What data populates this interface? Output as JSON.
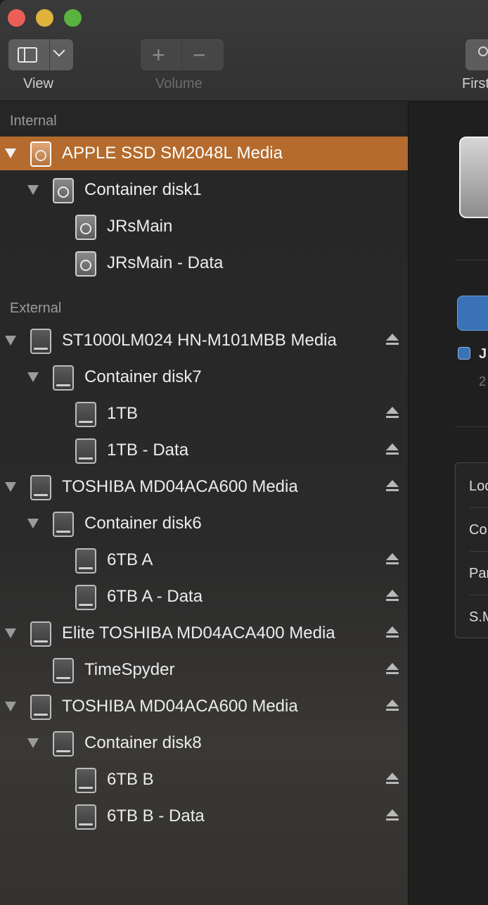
{
  "toolbar": {
    "view_label": "View",
    "volume_label": "Volume",
    "first_aid_label": "First Aid",
    "plus": "+",
    "minus": "−"
  },
  "sidebar": {
    "internal_header": "Internal",
    "external_header": "External",
    "items": [
      {
        "label": "APPLE SSD SM2048L Media"
      },
      {
        "label": "Container disk1"
      },
      {
        "label": "JRsMain"
      },
      {
        "label": "JRsMain - Data"
      },
      {
        "label": "ST1000LM024 HN-M101MBB Media"
      },
      {
        "label": "Container disk7"
      },
      {
        "label": "1TB"
      },
      {
        "label": "1TB - Data"
      },
      {
        "label": "TOSHIBA MD04ACA600 Media"
      },
      {
        "label": "Container disk6"
      },
      {
        "label": "6TB A"
      },
      {
        "label": "6TB A - Data"
      },
      {
        "label": "Elite TOSHIBA MD04ACA400 Media"
      },
      {
        "label": "TimeSpyder"
      },
      {
        "label": "TOSHIBA MD04ACA600 Media"
      },
      {
        "label": "Container disk8"
      },
      {
        "label": "6TB B"
      },
      {
        "label": "6TB B - Data"
      }
    ]
  },
  "detail": {
    "legend_letter": "J",
    "legend_sub": "2",
    "info_rows": [
      "Loc",
      "Co",
      "Par",
      "S.M"
    ]
  },
  "colors": {
    "selection": "#b46b2d",
    "accent_blue": "#3a72b7"
  }
}
